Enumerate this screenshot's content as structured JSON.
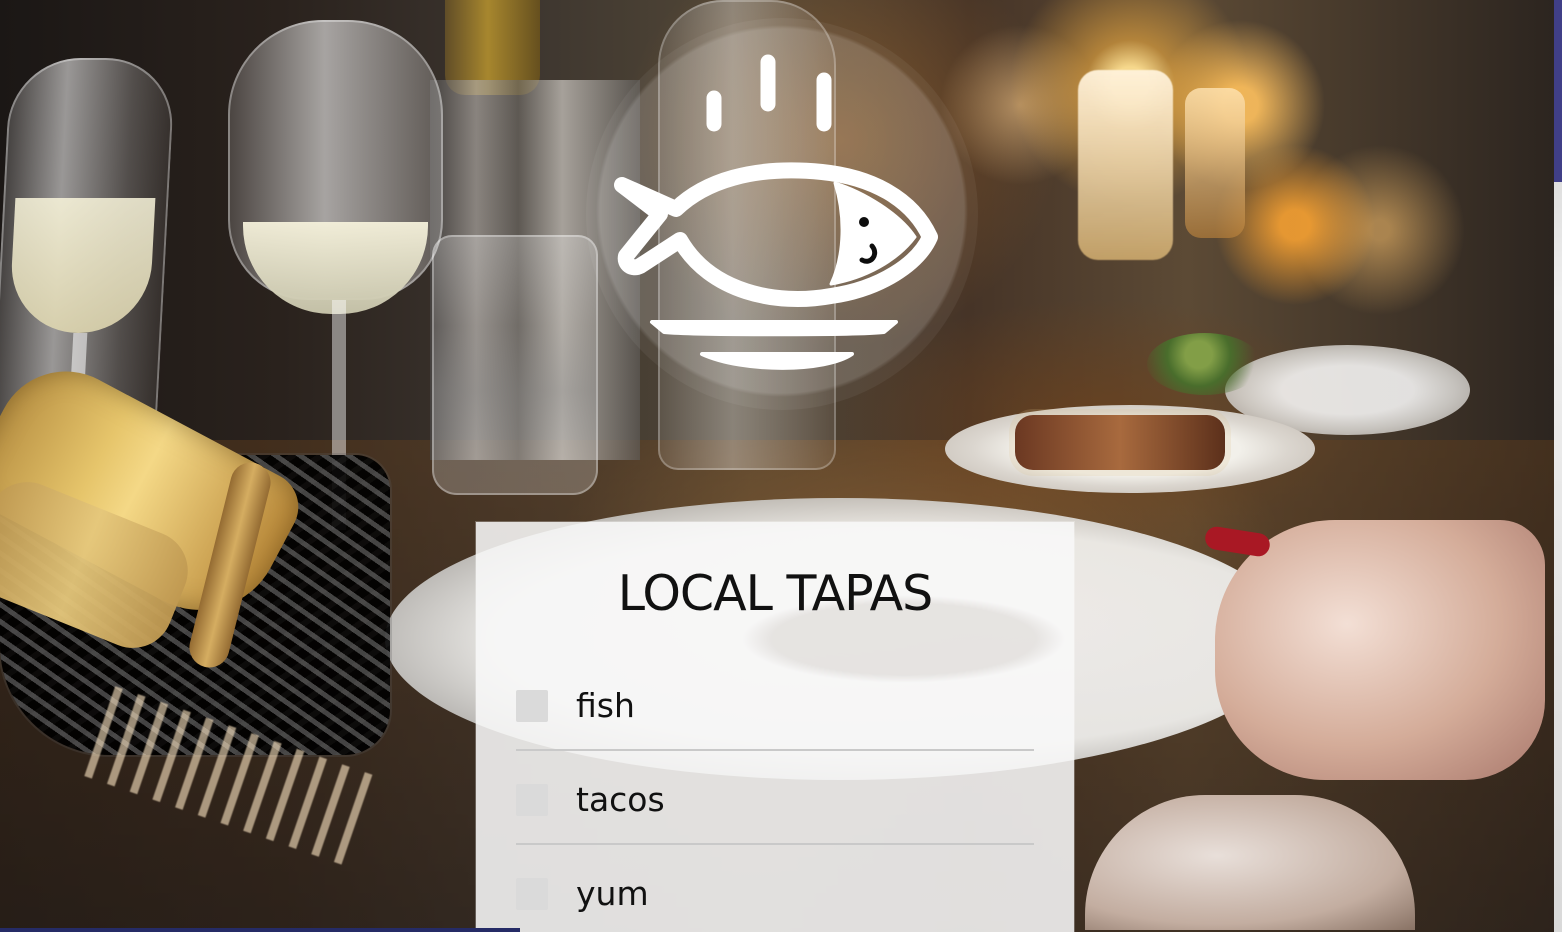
{
  "header": {
    "logo_name": "fish-plate-logo"
  },
  "menu": {
    "title": "LOCAL TAPAS",
    "items": [
      {
        "label": "fish"
      },
      {
        "label": "tacos"
      },
      {
        "label": "yum"
      }
    ]
  },
  "colors": {
    "panel_background": "#f8f8f8",
    "text": "#111111",
    "checkbox": "#dadada",
    "accent_blue": "#403f87"
  }
}
